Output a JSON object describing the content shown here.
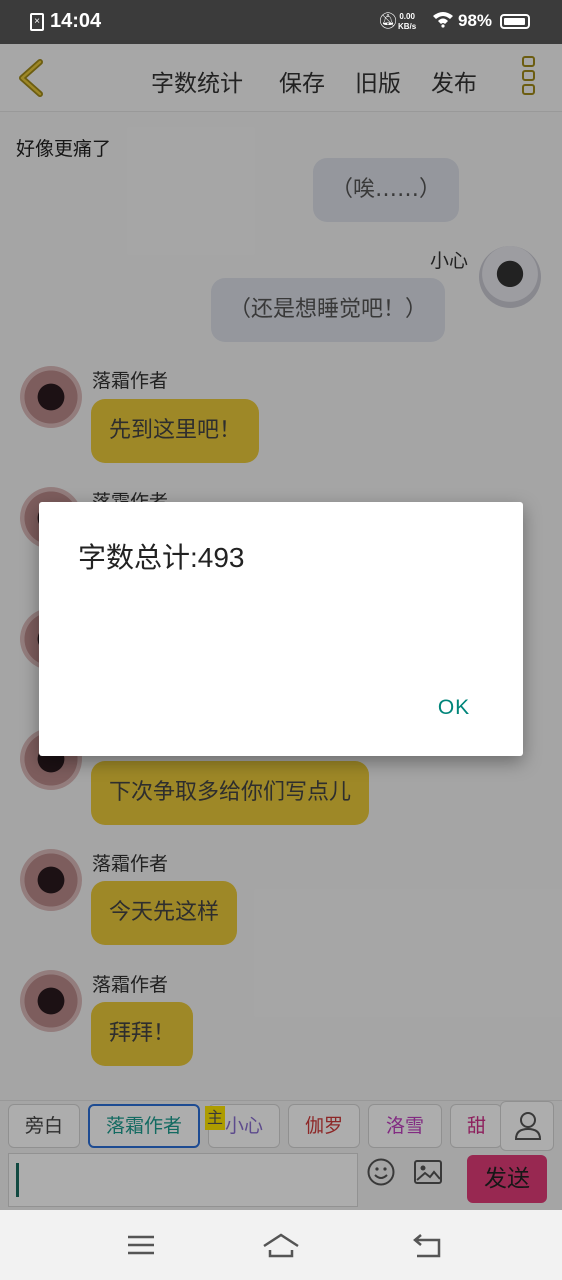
{
  "status": {
    "time": "14:04",
    "net_speed_value": "0.00",
    "net_speed_unit": "KB/s",
    "battery": "98%"
  },
  "topbar": {
    "menu": [
      "字数统计",
      "保存",
      "旧版",
      "发布"
    ],
    "accent": "#a08a1a"
  },
  "chat": {
    "title": "好像更痛了",
    "messages": [
      {
        "speaker": "",
        "text": "（唉……）",
        "side": "right"
      },
      {
        "speaker": "小心",
        "text": "（还是想睡觉吧！）",
        "side": "right"
      },
      {
        "speaker": "落霜作者",
        "text": "先到这里吧！",
        "side": "left"
      },
      {
        "speaker": "落霜作者",
        "text": "",
        "side": "left"
      },
      {
        "speaker": "",
        "text": "",
        "side": "left"
      },
      {
        "speaker": "",
        "text": "下次争取多给你们写点儿",
        "side": "left"
      },
      {
        "speaker": "落霜作者",
        "text": "今天先这样",
        "side": "left"
      },
      {
        "speaker": "落霜作者",
        "text": "拜拜！",
        "side": "left"
      }
    ]
  },
  "dialog": {
    "message": "字数总计:493",
    "ok_label": "OK"
  },
  "characters": [
    {
      "label": "旁白",
      "color": "#444444"
    },
    {
      "label": "落霜作者",
      "color": "#1d9c8f"
    },
    {
      "label": "小心",
      "color": "#8a6fd0"
    },
    {
      "label": "伽罗",
      "color": "#d03a3a"
    },
    {
      "label": "洛雪",
      "color": "#c040c0"
    },
    {
      "label": "甜心",
      "color": "#d0308a"
    }
  ],
  "character_badge": "主",
  "input": {
    "value": ""
  },
  "send_label": "发送",
  "colors": {
    "gold_bubble": "#e9c93a",
    "send": "#e13c78",
    "ok": "#00857a",
    "selected_chip": "#2b6fd8"
  }
}
